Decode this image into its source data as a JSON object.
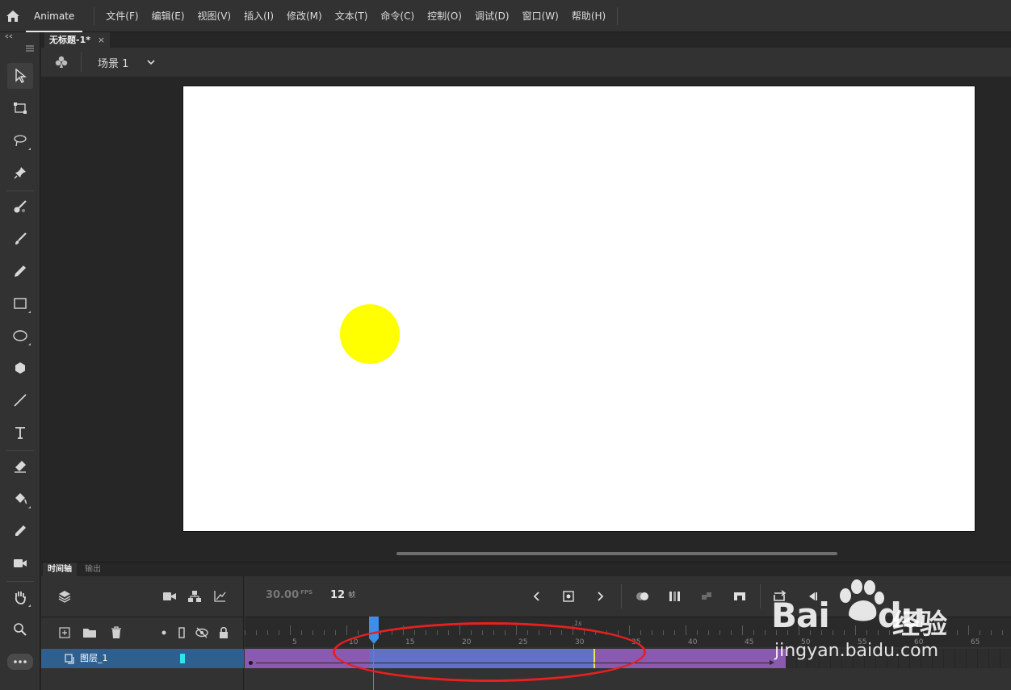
{
  "app": {
    "name": "Animate",
    "menu": [
      "文件(F)",
      "编辑(E)",
      "视图(V)",
      "插入(I)",
      "修改(M)",
      "文本(T)",
      "命令(C)",
      "控制(O)",
      "调试(D)",
      "窗口(W)",
      "帮助(H)"
    ]
  },
  "document": {
    "tab_title": "无标题-1*",
    "close_glyph": "×"
  },
  "scene": {
    "label": "场景 1"
  },
  "stage": {
    "background": "#ffffff",
    "ball_color": "#ffff00"
  },
  "panel_tabs": {
    "timeline": "时间轴",
    "output": "输出"
  },
  "timeline": {
    "fps_value": "30.00",
    "fps_unit": "FPS",
    "current_frame": "12",
    "frame_unit": "帧",
    "layer_name": "图层_1",
    "layer_color": "#2fe3ec",
    "second_marker": "1s",
    "ruler_labels": [
      "5",
      "10",
      "15",
      "20",
      "25",
      "30",
      "35",
      "40",
      "45",
      "50",
      "55",
      "60",
      "65"
    ],
    "tween_color": "#8a5ab0",
    "selected_color": "#6271c8"
  },
  "watermark": {
    "logo": "Bai",
    "logo2": "du",
    "cn": "经验",
    "site": "jingyan.baidu.com"
  }
}
